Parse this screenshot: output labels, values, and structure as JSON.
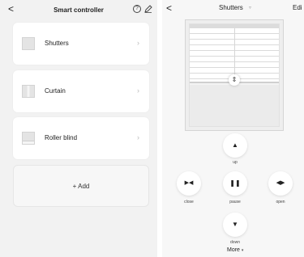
{
  "left": {
    "header": {
      "back_icon": "chevron-left-icon",
      "back_glyph": "<",
      "title": "Smart controller",
      "info_glyph": "?",
      "edit_icon": "pencil-icon"
    },
    "devices": [
      {
        "label": "Shutters",
        "icon": "shutters-thumbnail-icon",
        "chevron": "›"
      },
      {
        "label": "Curtain",
        "icon": "curtain-thumbnail-icon",
        "chevron": "›"
      },
      {
        "label": "Roller blind",
        "icon": "roller-blind-thumbnail-icon",
        "chevron": "›"
      }
    ],
    "add": {
      "label": "+ Add"
    }
  },
  "right": {
    "header": {
      "back_glyph": "<",
      "title": "Shutters",
      "title_caret": "▿",
      "edit_label": "Edi"
    },
    "handle_glyph": "⇕",
    "controls": {
      "up": {
        "label": "up",
        "glyph": "▲"
      },
      "close": {
        "label": "close",
        "glyph": "▶◀"
      },
      "pause": {
        "label": "pause",
        "glyph": "❚❚"
      },
      "open": {
        "label": "open",
        "glyph": "◀▶"
      },
      "down": {
        "label": "down",
        "glyph": "▼"
      }
    },
    "more": {
      "label": "More",
      "caret": "▾"
    }
  }
}
